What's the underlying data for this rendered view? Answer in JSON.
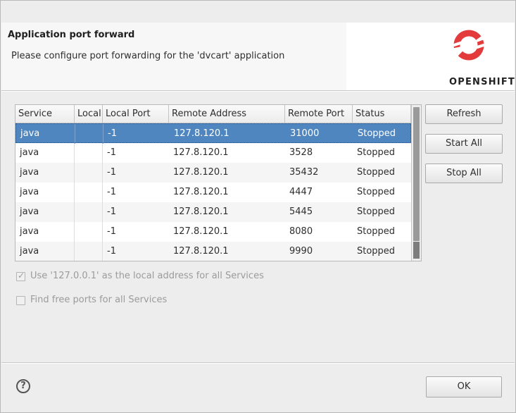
{
  "header": {
    "title": "Application port forward",
    "description": "Please configure port forwarding for the 'dvcart' application",
    "logo_text": "OPENSHIFT",
    "logo_color": "#e33b3b"
  },
  "table": {
    "columns": [
      "Service",
      "Local",
      "Local Port",
      "Remote Address",
      "Remote Port",
      "Status"
    ],
    "rows": [
      {
        "service": "java",
        "local": "",
        "local_port": "-1",
        "remote_address": "127.8.120.1",
        "remote_port": "31000",
        "status": "Stopped",
        "selected": true
      },
      {
        "service": "java",
        "local": "",
        "local_port": "-1",
        "remote_address": "127.8.120.1",
        "remote_port": "3528",
        "status": "Stopped"
      },
      {
        "service": "java",
        "local": "",
        "local_port": "-1",
        "remote_address": "127.8.120.1",
        "remote_port": "35432",
        "status": "Stopped"
      },
      {
        "service": "java",
        "local": "",
        "local_port": "-1",
        "remote_address": "127.8.120.1",
        "remote_port": "4447",
        "status": "Stopped"
      },
      {
        "service": "java",
        "local": "",
        "local_port": "-1",
        "remote_address": "127.8.120.1",
        "remote_port": "5445",
        "status": "Stopped"
      },
      {
        "service": "java",
        "local": "",
        "local_port": "-1",
        "remote_address": "127.8.120.1",
        "remote_port": "8080",
        "status": "Stopped"
      },
      {
        "service": "java",
        "local": "",
        "local_port": "-1",
        "remote_address": "127.8.120.1",
        "remote_port": "9990",
        "status": "Stopped"
      }
    ],
    "selection_color": "#4f86c0"
  },
  "buttons": {
    "refresh": "Refresh",
    "start_all": "Start All",
    "stop_all": "Stop All",
    "ok": "OK"
  },
  "options": {
    "use_localhost": {
      "label": "Use '127.0.0.1' as the local address for all Services",
      "checked": true,
      "enabled": false
    },
    "find_free_ports": {
      "label": "Find free ports for all Services",
      "checked": false,
      "enabled": false
    }
  },
  "footer": {
    "help_icon": "?"
  }
}
